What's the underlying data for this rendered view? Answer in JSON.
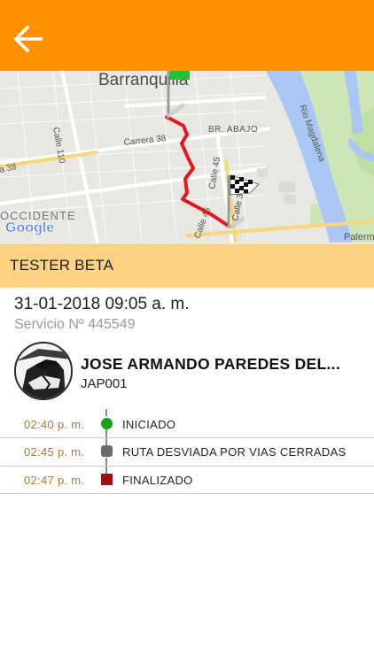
{
  "header": {
    "back_icon": "arrow-left-icon",
    "color": "#ff9100"
  },
  "map": {
    "labels": {
      "city": "Barranquilla",
      "neighborhood_top": "BR. ABAJO",
      "street_1": "Carrera 38",
      "street_2": "Calle 110",
      "street_3": "Calle 45",
      "street_4": "Calle 45",
      "street_5": "Calle 30",
      "river": "Rio Magdalena",
      "district": "OCCIDENTE",
      "edge_left": "a 38",
      "edge_right": "Palerm",
      "provider": "Google"
    },
    "route_color": "#e0191c",
    "start_flag_color": "#21c231",
    "end_flag_icon": "checkered-flag-icon"
  },
  "section": {
    "title": "TESTER BETA",
    "color": "#fdd283"
  },
  "service": {
    "date": "31-01-2018 09:05 a. m.",
    "number_label": "Servicio Nº 445549"
  },
  "driver": {
    "name": "JOSE ARMANDO PAREDES  DEL...",
    "plate": "JAP001",
    "avatar_icon": "driver-avatar-icon"
  },
  "timeline": [
    {
      "time": "02:40 p. m.",
      "status": "INICIADO",
      "marker": "circle",
      "color": "#16a316"
    },
    {
      "time": "02:45 p. m.",
      "status": "RUTA DESVIADA POR VIAS CERRADAS",
      "marker": "rounded-square",
      "color": "#6a6a6a"
    },
    {
      "time": "02:47 p. m.",
      "status": "FINALIZADO",
      "marker": "square",
      "color": "#a01010"
    }
  ]
}
